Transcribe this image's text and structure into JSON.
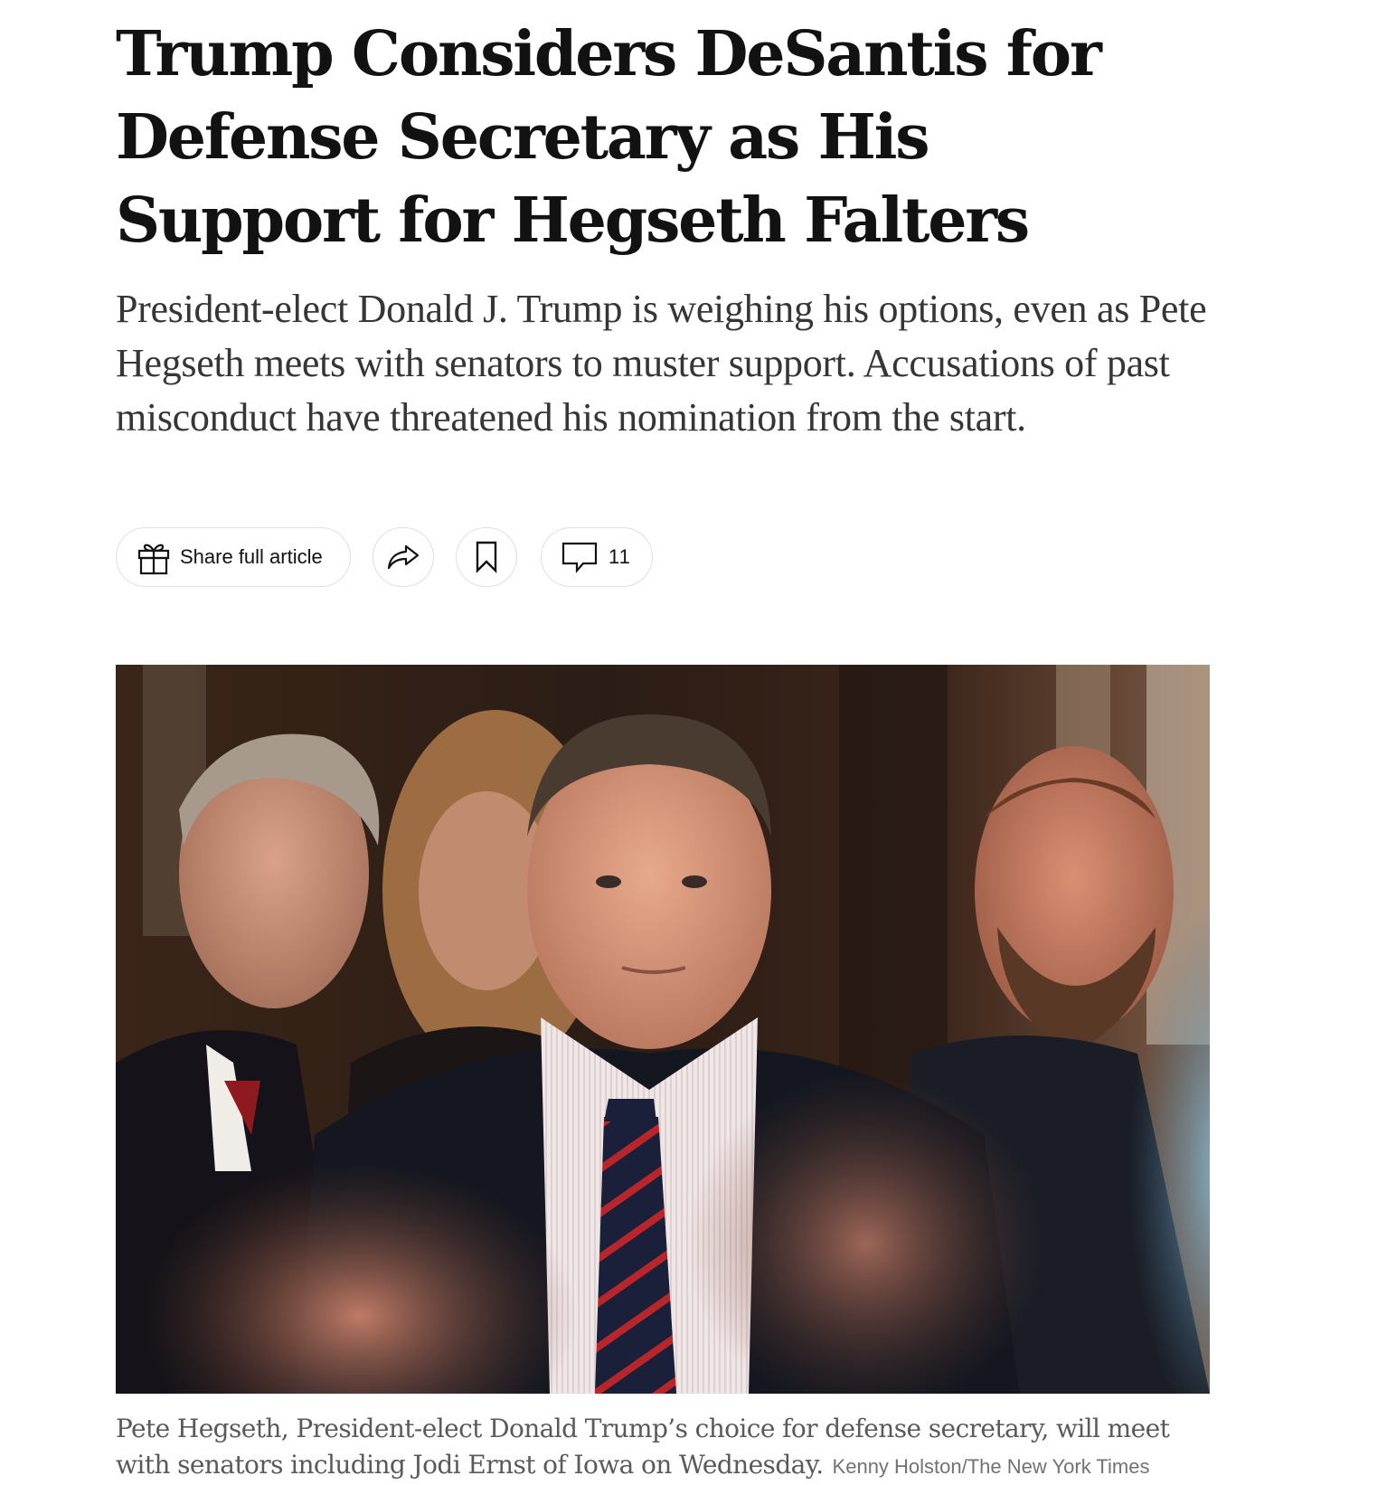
{
  "article": {
    "headline": "Trump Considers DeSantis for Defense Secretary as His Support for Hegseth Falters",
    "summary": "President-elect Donald J. Trump is weighing his options, even as Pete Hegseth meets with senators to muster support. Accusations of past misconduct have threatened his nomination from the start."
  },
  "toolbar": {
    "share_full_article_label": "Share full article",
    "share_icon": "share-arrow-icon",
    "save_icon": "bookmark-icon",
    "comments_icon": "comment-bubble-icon",
    "gift_icon": "gift-icon",
    "comments_count": "11"
  },
  "photo": {
    "caption": "Pete Hegseth, President-elect Donald Trump’s choice for defense secretary, will meet with senators including Jodi Ernst of Iowa on Wednesday.",
    "credit": "Kenny Holston/The New York Times"
  }
}
